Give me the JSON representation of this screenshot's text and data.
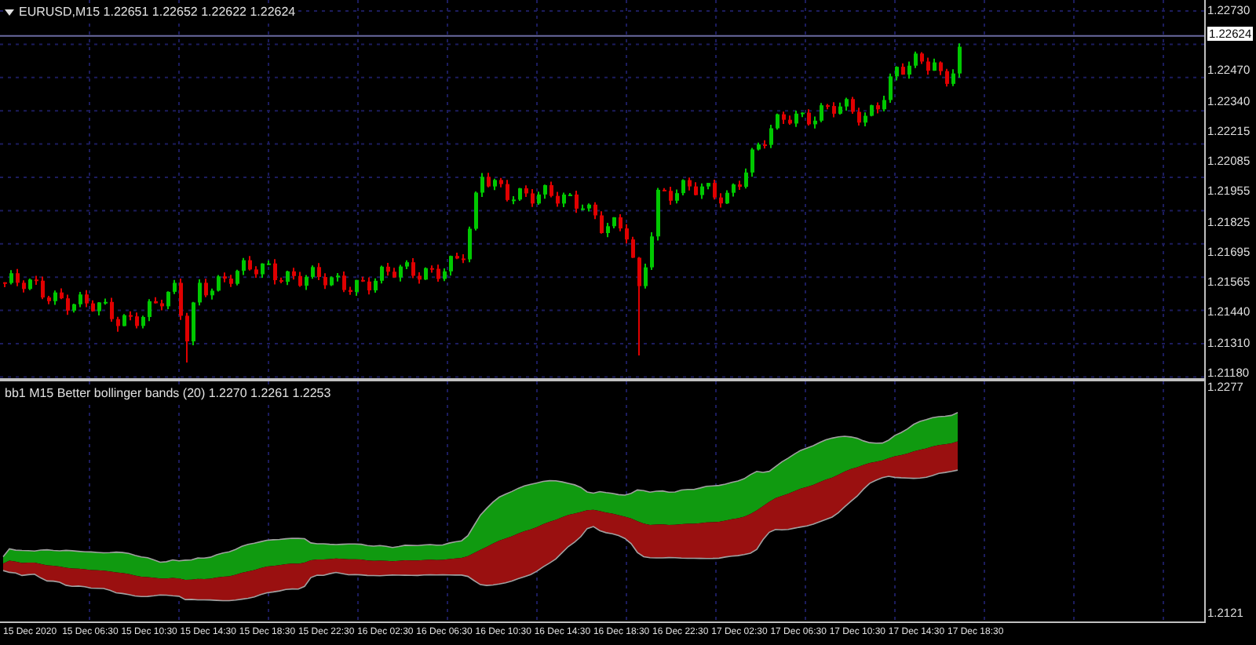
{
  "chart": {
    "title": "EURUSD,M15  1.22651 1.22652 1.22622 1.22624",
    "price_labels": [
      "1.22730",
      "1.22470",
      "1.22340",
      "1.22215",
      "1.22085",
      "1.21955",
      "1.21825",
      "1.21695",
      "1.21565",
      "1.21440",
      "1.21310",
      "1.21180"
    ],
    "current_price": "1.22624"
  },
  "indicator": {
    "title": "bb1  M15 Better bollinger bands (20) 1.2270 1.2261 1.2253",
    "scale_labels": [
      "1.2277",
      "1.2121"
    ]
  },
  "time_axis": [
    "15 Dec 2020",
    "15 Dec 06:30",
    "15 Dec 10:30",
    "15 Dec 14:30",
    "15 Dec 18:30",
    "15 Dec 22:30",
    "16 Dec 02:30",
    "16 Dec 06:30",
    "16 Dec 10:30",
    "16 Dec 14:30",
    "16 Dec 18:30",
    "16 Dec 22:30",
    "17 Dec 02:30",
    "17 Dec 06:30",
    "17 Dec 10:30",
    "17 Dec 14:30",
    "17 Dec 18:30"
  ]
}
